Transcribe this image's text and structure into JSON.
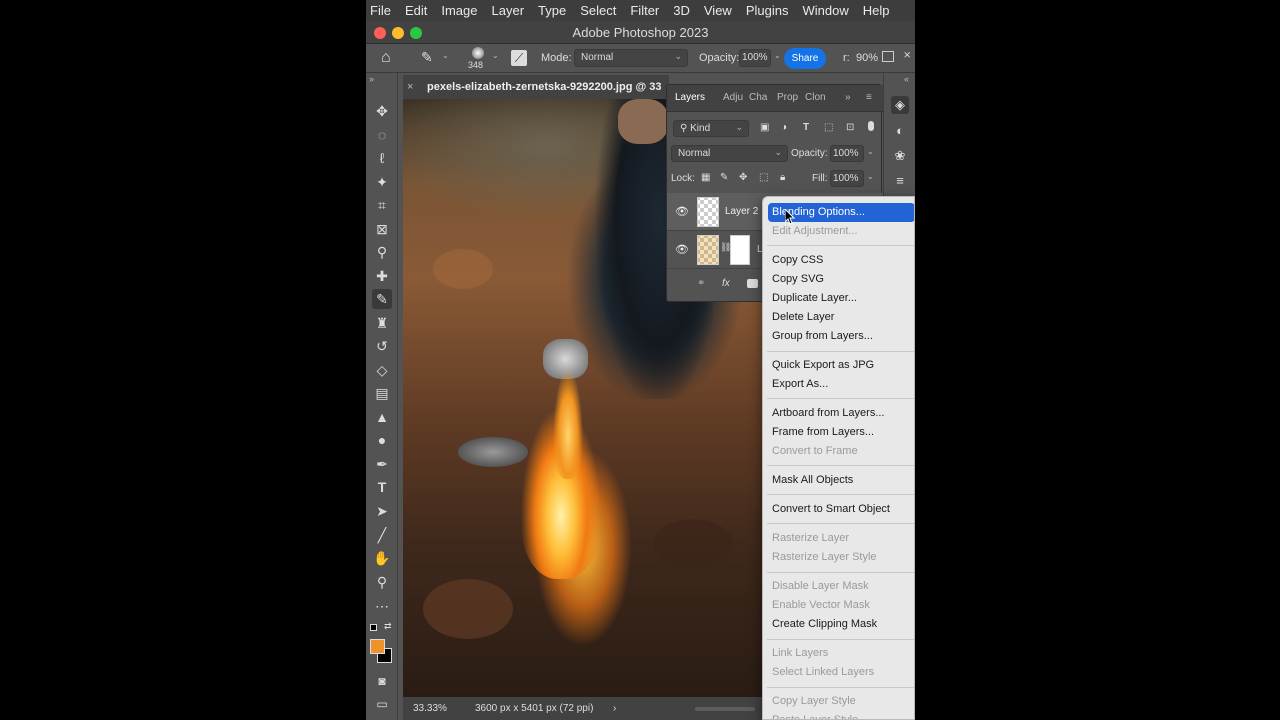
{
  "menubar": {
    "items": [
      "File",
      "Edit",
      "Image",
      "Layer",
      "Type",
      "Select",
      "Filter",
      "3D",
      "View",
      "Plugins",
      "Window",
      "Help"
    ]
  },
  "window": {
    "title": "Adobe Photoshop 2023",
    "traffic_colors": [
      "#ff5f57",
      "#febc2e",
      "#28c840"
    ]
  },
  "options": {
    "brush_size": "348",
    "mode_label": "Mode:",
    "mode_value": "Normal",
    "opacity_label": "Opacity:",
    "opacity_value": "100%",
    "share": "Share",
    "flow_label": "r:",
    "flow_value": "90%"
  },
  "document": {
    "tab_title": "pexels-elizabeth-zernetska-9292200.jpg @ 33",
    "zoom": "33.33%",
    "dimensions": "3600 px x 5401 px (72 ppi)"
  },
  "colors": {
    "foreground": "#f0922b",
    "background": "#000000",
    "accent": "#2264d6"
  },
  "layers_panel": {
    "tabs": [
      "Layers",
      "Adju",
      "Cha",
      "Prop",
      "Clon"
    ],
    "kind_label": "Kind",
    "blend_mode": "Normal",
    "opacity_label": "Opacity:",
    "opacity_value": "100%",
    "lock_label": "Lock:",
    "fill_label": "Fill:",
    "fill_value": "100%",
    "layers": [
      {
        "name": "Layer 2"
      },
      {
        "name": "L"
      }
    ],
    "footer_fx": "fx"
  },
  "context_menu": {
    "items": [
      {
        "label": "Blending Options...",
        "state": "highlighted"
      },
      {
        "label": "Edit Adjustment...",
        "state": "disabled"
      },
      {
        "label": "Copy CSS",
        "state": "enabled"
      },
      {
        "label": "Copy SVG",
        "state": "enabled"
      },
      {
        "label": "Duplicate Layer...",
        "state": "enabled"
      },
      {
        "label": "Delete Layer",
        "state": "enabled"
      },
      {
        "label": "Group from Layers...",
        "state": "enabled"
      },
      {
        "label": "Quick Export as JPG",
        "state": "enabled"
      },
      {
        "label": "Export As...",
        "state": "enabled"
      },
      {
        "label": "Artboard from Layers...",
        "state": "enabled"
      },
      {
        "label": "Frame from Layers...",
        "state": "enabled"
      },
      {
        "label": "Convert to Frame",
        "state": "disabled"
      },
      {
        "label": "Mask All Objects",
        "state": "enabled"
      },
      {
        "label": "Convert to Smart Object",
        "state": "enabled"
      },
      {
        "label": "Rasterize Layer",
        "state": "disabled"
      },
      {
        "label": "Rasterize Layer Style",
        "state": "disabled"
      },
      {
        "label": "Disable Layer Mask",
        "state": "disabled"
      },
      {
        "label": "Enable Vector Mask",
        "state": "disabled"
      },
      {
        "label": "Create Clipping Mask",
        "state": "enabled"
      },
      {
        "label": "Link Layers",
        "state": "disabled"
      },
      {
        "label": "Select Linked Layers",
        "state": "disabled"
      },
      {
        "label": "Copy Layer Style",
        "state": "disabled"
      },
      {
        "label": "Paste Layer Style",
        "state": "disabled"
      }
    ]
  }
}
